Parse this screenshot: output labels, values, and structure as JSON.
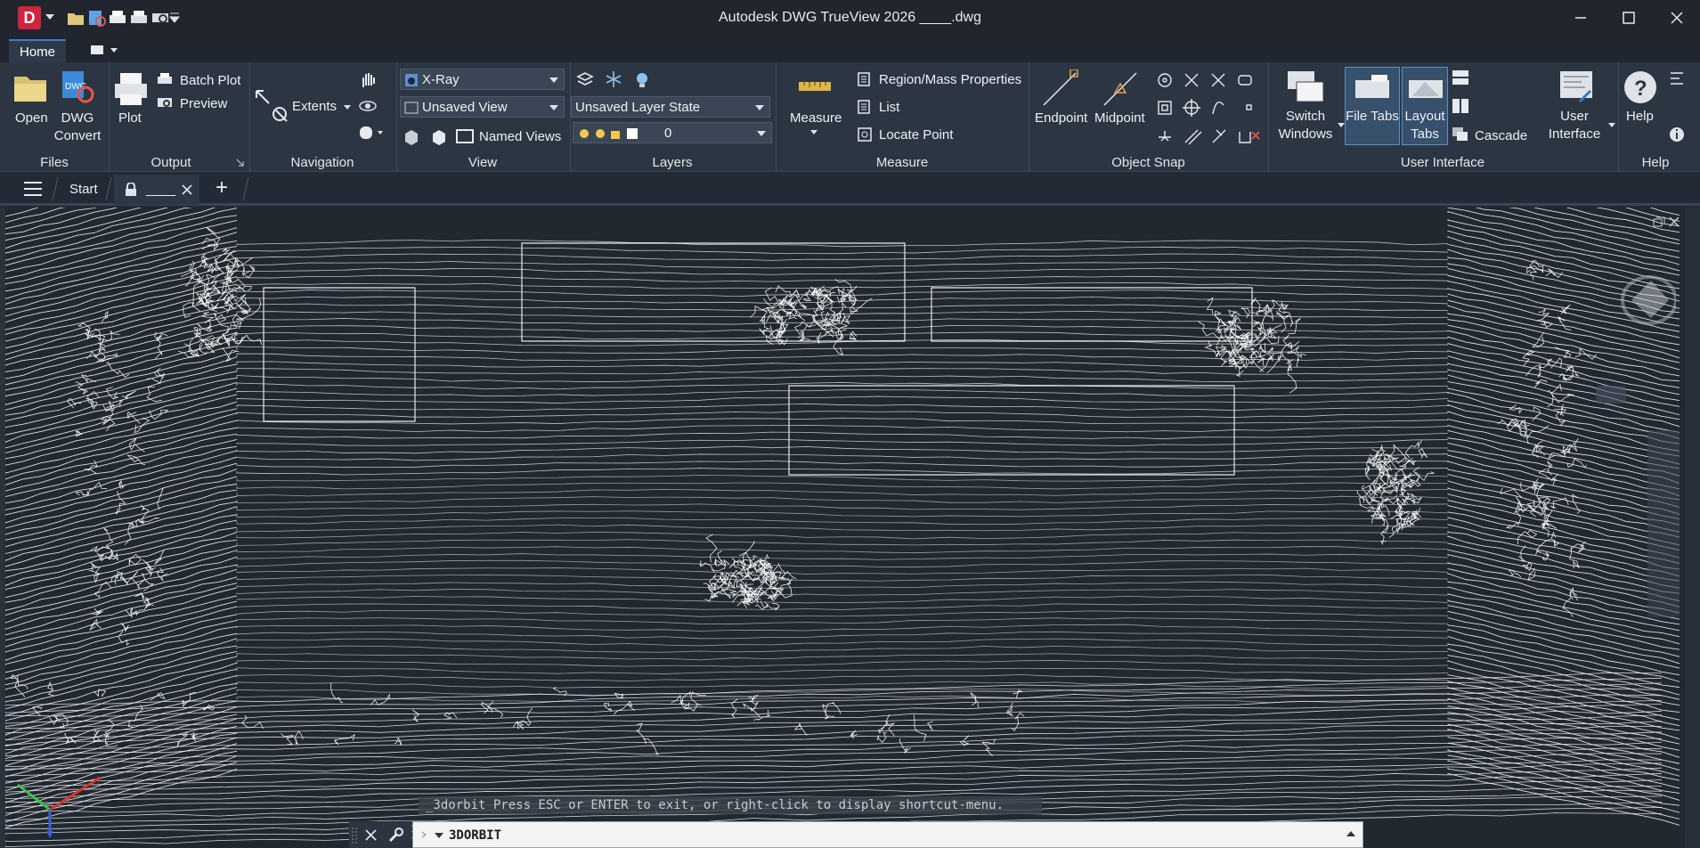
{
  "titlebar": {
    "app_icon": "D",
    "title": "Autodesk DWG TrueView 2026     ____.dwg",
    "quick_access": [
      "dropdown-icon",
      "open-folder-icon",
      "dwg-convert-icon",
      "plot-icon",
      "batch-plot-icon",
      "preview-icon",
      "customize-icon"
    ],
    "window_controls": [
      "minimize-icon",
      "maximize-icon",
      "close-icon"
    ]
  },
  "ribbon": {
    "tabs": [
      {
        "label": "Home"
      }
    ],
    "panels": {
      "files": {
        "title": "Files",
        "open": "Open",
        "dwg": "DWG",
        "convert": "Convert"
      },
      "output": {
        "title": "Output",
        "plot": "Plot",
        "batch_plot": "Batch Plot",
        "preview": "Preview"
      },
      "navigation": {
        "title": "Navigation",
        "extents": "Extents"
      },
      "view": {
        "title": "View",
        "visual_style": "X-Ray",
        "named_view": "Unsaved View",
        "named_views": "Named Views"
      },
      "layers": {
        "title": "Layers",
        "layer_state": "Unsaved Layer State",
        "current_layer": "0"
      },
      "measure": {
        "title": "Measure",
        "measure": "Measure",
        "region_mass": "Region/Mass Properties",
        "list": "List",
        "locate_point": "Locate Point"
      },
      "object_snap": {
        "title": "Object Snap",
        "endpoint": "Endpoint",
        "midpoint": "Midpoint"
      },
      "user_interface": {
        "title": "User Interface",
        "switch": "Switch",
        "windows": "Windows",
        "file_tabs": "File Tabs",
        "layout": "Layout",
        "tabs": "Tabs",
        "cascade": "Cascade",
        "user": "User",
        "interface": "Interface"
      },
      "help": {
        "title": "Help",
        "help": "Help"
      }
    }
  },
  "file_tabs": {
    "start": "Start",
    "active_file": "____",
    "add": "+"
  },
  "command_line": {
    "history": "_3dorbit Press ESC or ENTER to exit, or right-click to display shortcut-menu.",
    "current": "3DORBIT"
  },
  "colors": {
    "accent": "#3b78c8",
    "app_red": "#d0243f",
    "canvas": "#212830",
    "ribbon": "#2c3642"
  }
}
